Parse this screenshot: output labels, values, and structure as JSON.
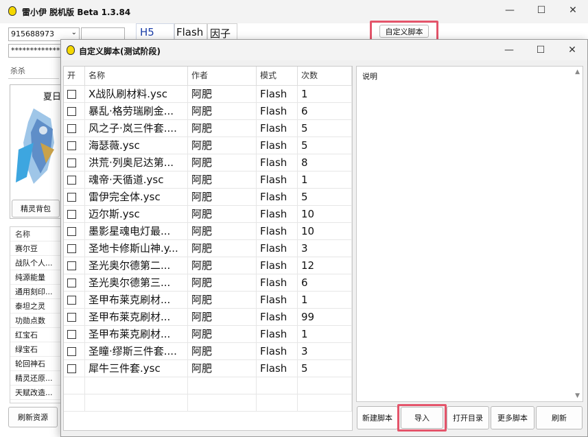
{
  "main_window": {
    "title": "雷小伊 脱机版 Beta 1.3.84",
    "account": "915688973",
    "password": "**************",
    "kill_label": "杀杀",
    "tabs": [
      "H5",
      "Flash",
      "因子"
    ],
    "custom_script_button": "自定义脚本",
    "pet_name": "夏日",
    "pet_bag_button": "精灵背包",
    "resource_header": "名称",
    "resources": [
      "赛尔豆",
      "战队个人...",
      "纯源能量",
      "通用刻印...",
      "泰坦之灵",
      "功勋点数",
      "红宝石",
      "绿宝石",
      "轮回神石",
      "精灵还原...",
      "天赋改造..."
    ],
    "refresh_resources_button": "刷新资源"
  },
  "dialog": {
    "title": "自定义脚本(测试阶段)",
    "columns": [
      "开",
      "名称",
      "作者",
      "模式",
      "次数"
    ],
    "rows": [
      {
        "name": "X战队刷材料.ysc",
        "author": "阿肥",
        "mode": "Flash",
        "count": "1"
      },
      {
        "name": "暴乱·格劳瑞刷金...",
        "author": "阿肥",
        "mode": "Flash",
        "count": "6"
      },
      {
        "name": "风之子·岚三件套....",
        "author": "阿肥",
        "mode": "Flash",
        "count": "5"
      },
      {
        "name": "海瑟薇.ysc",
        "author": "阿肥",
        "mode": "Flash",
        "count": "5"
      },
      {
        "name": "洪荒·列奥尼达第...",
        "author": "阿肥",
        "mode": "Flash",
        "count": "8"
      },
      {
        "name": "魂帝·天循道.ysc",
        "author": "阿肥",
        "mode": "Flash",
        "count": "1"
      },
      {
        "name": "雷伊完全体.ysc",
        "author": "阿肥",
        "mode": "Flash",
        "count": "5"
      },
      {
        "name": "迈尔斯.ysc",
        "author": "阿肥",
        "mode": "Flash",
        "count": "10"
      },
      {
        "name": "墨影星魂电灯最...",
        "author": "阿肥",
        "mode": "Flash",
        "count": "10"
      },
      {
        "name": "圣地卡修斯山神.y...",
        "author": "阿肥",
        "mode": "Flash",
        "count": "3"
      },
      {
        "name": "圣光奥尔德第二...",
        "author": "阿肥",
        "mode": "Flash",
        "count": "12"
      },
      {
        "name": "圣光奥尔德第三...",
        "author": "阿肥",
        "mode": "Flash",
        "count": "6"
      },
      {
        "name": "圣甲布莱克刷材...",
        "author": "阿肥",
        "mode": "Flash",
        "count": "1"
      },
      {
        "name": "圣甲布莱克刷材...",
        "author": "阿肥",
        "mode": "Flash",
        "count": "99"
      },
      {
        "name": "圣甲布莱克刷材...",
        "author": "阿肥",
        "mode": "Flash",
        "count": "1"
      },
      {
        "name": "圣瞳·缪斯三件套....",
        "author": "阿肥",
        "mode": "Flash",
        "count": "3"
      },
      {
        "name": "犀牛三件套.ysc",
        "author": "阿肥",
        "mode": "Flash",
        "count": "5"
      }
    ],
    "description_label": "说明",
    "buttons": {
      "new": "新建脚本",
      "import": "导入",
      "open_dir": "打开目录",
      "more": "更多脚本",
      "refresh": "刷新"
    }
  },
  "colors": {
    "highlight": "#e4546a",
    "icon_yellow": "#f5d800"
  }
}
